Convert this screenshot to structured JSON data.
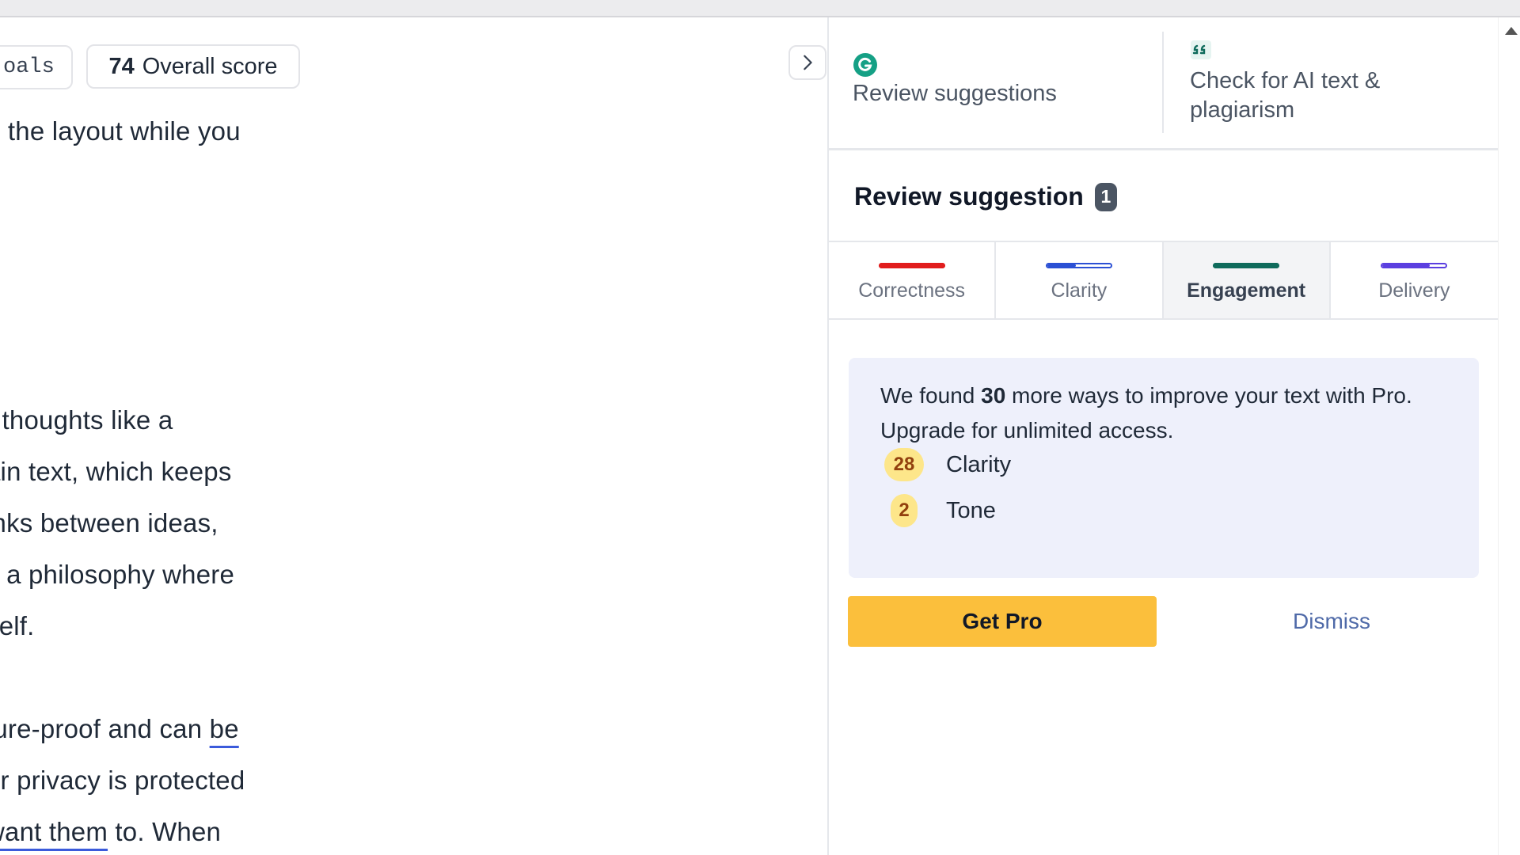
{
  "toolbar": {
    "goals_label": "oals",
    "score_value": "74",
    "score_label": "Overall score"
  },
  "document": {
    "lines": [
      "e the layout while you",
      "r thoughts like a",
      "ain text, which keeps",
      "inks between ideas,",
      "s a philosophy where",
      "self.",
      "ture-proof and can ",
      "ur privacy is protected",
      " to. When"
    ],
    "underlined": [
      "be",
      "want them"
    ]
  },
  "sidebar": {
    "top_tabs": {
      "review_label": "Review suggestions",
      "check_label": "Check for AI text & plagiarism"
    },
    "header": {
      "title": "Review suggestion",
      "count": "1"
    },
    "categories": [
      {
        "label": "Correctness",
        "color": "#e11d1d",
        "fill": 1.0
      },
      {
        "label": "Clarity",
        "color": "#2b50d4",
        "fill": 0.45
      },
      {
        "label": "Engagement",
        "color": "#0f6b5c",
        "fill": 1.0
      },
      {
        "label": "Delivery",
        "color": "#5b3fe0",
        "fill": 0.75
      }
    ],
    "promo": {
      "text_before": "We found ",
      "count": "30",
      "text_after": " more ways to improve your text with Pro. Upgrade for unlimited access.",
      "items": [
        {
          "count": "28",
          "label": "Clarity"
        },
        {
          "count": "2",
          "label": "Tone"
        }
      ]
    },
    "buttons": {
      "get_pro": "Get Pro",
      "dismiss": "Dismiss"
    }
  },
  "colors": {
    "accent": "#fbbf3c",
    "brand": "#15a085",
    "promo_bg": "#eef0fb"
  }
}
